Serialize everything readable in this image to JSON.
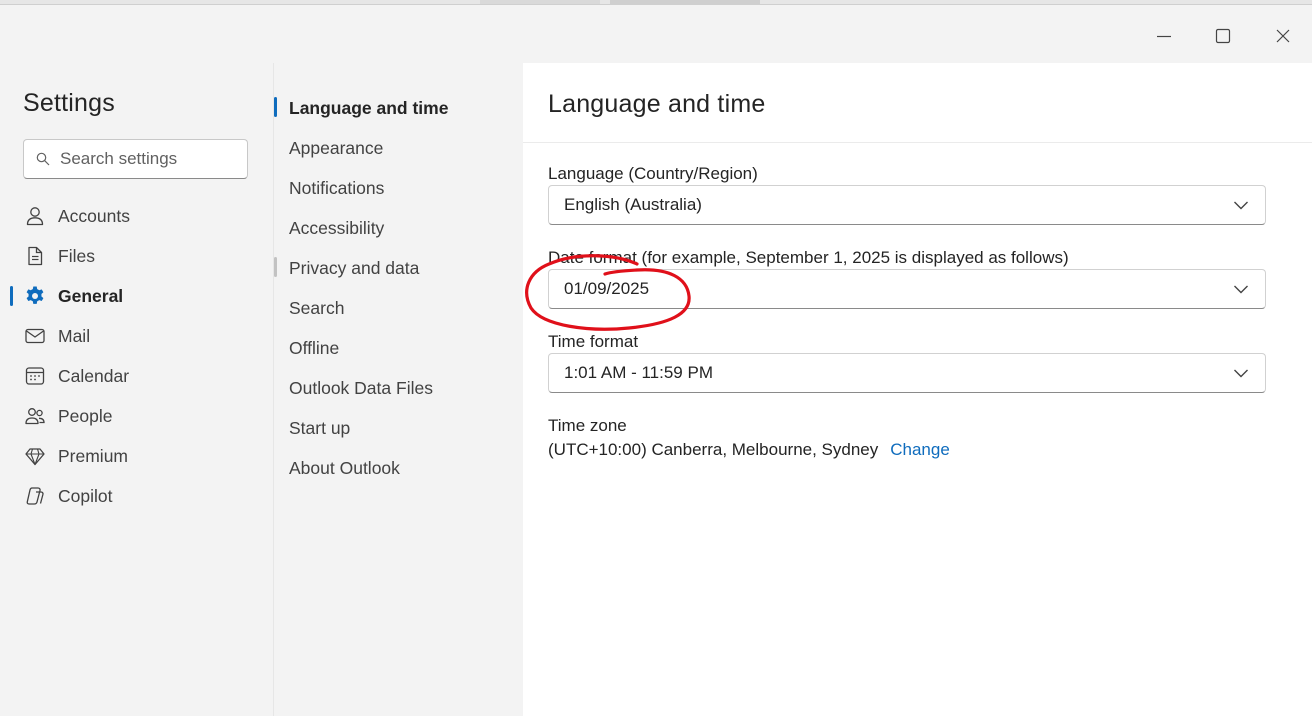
{
  "window": {
    "controls": {
      "minimize_icon": "minimize-icon",
      "maximize_icon": "maximize-icon",
      "close_icon": "close-icon"
    }
  },
  "nav": {
    "title": "Settings",
    "search": {
      "placeholder": "Search settings",
      "value": ""
    },
    "items": [
      {
        "label": "Accounts",
        "icon": "person-icon"
      },
      {
        "label": "Files",
        "icon": "document-icon"
      },
      {
        "label": "General",
        "icon": "gear-icon",
        "active": true
      },
      {
        "label": "Mail",
        "icon": "mail-icon"
      },
      {
        "label": "Calendar",
        "icon": "calendar-icon"
      },
      {
        "label": "People",
        "icon": "people-icon"
      },
      {
        "label": "Premium",
        "icon": "diamond-icon"
      },
      {
        "label": "Copilot",
        "icon": "copilot-icon"
      }
    ]
  },
  "subnav": {
    "items": [
      {
        "label": "Language and time",
        "active": true
      },
      {
        "label": "Appearance"
      },
      {
        "label": "Notifications"
      },
      {
        "label": "Accessibility"
      },
      {
        "label": "Privacy and data"
      },
      {
        "label": "Search"
      },
      {
        "label": "Offline"
      },
      {
        "label": "Outlook Data Files"
      },
      {
        "label": "Start up"
      },
      {
        "label": "About Outlook"
      }
    ]
  },
  "content": {
    "title": "Language and time",
    "language": {
      "label": "Language (Country/Region)",
      "value": "English (Australia)"
    },
    "date_format": {
      "label": "Date format (for example, September 1, 2025 is displayed as follows)",
      "value": "01/09/2025"
    },
    "time_format": {
      "label": "Time format",
      "value": "1:01 AM - 11:59 PM"
    },
    "time_zone": {
      "label": "Time zone",
      "value": "(UTC+10:00) Canberra, Melbourne, Sydney",
      "change_label": "Change"
    }
  },
  "colors": {
    "accent": "#0f6cbd",
    "annotation": "#e0101a",
    "nav_bg": "#f3f3f3",
    "content_bg": "#ffffff"
  }
}
